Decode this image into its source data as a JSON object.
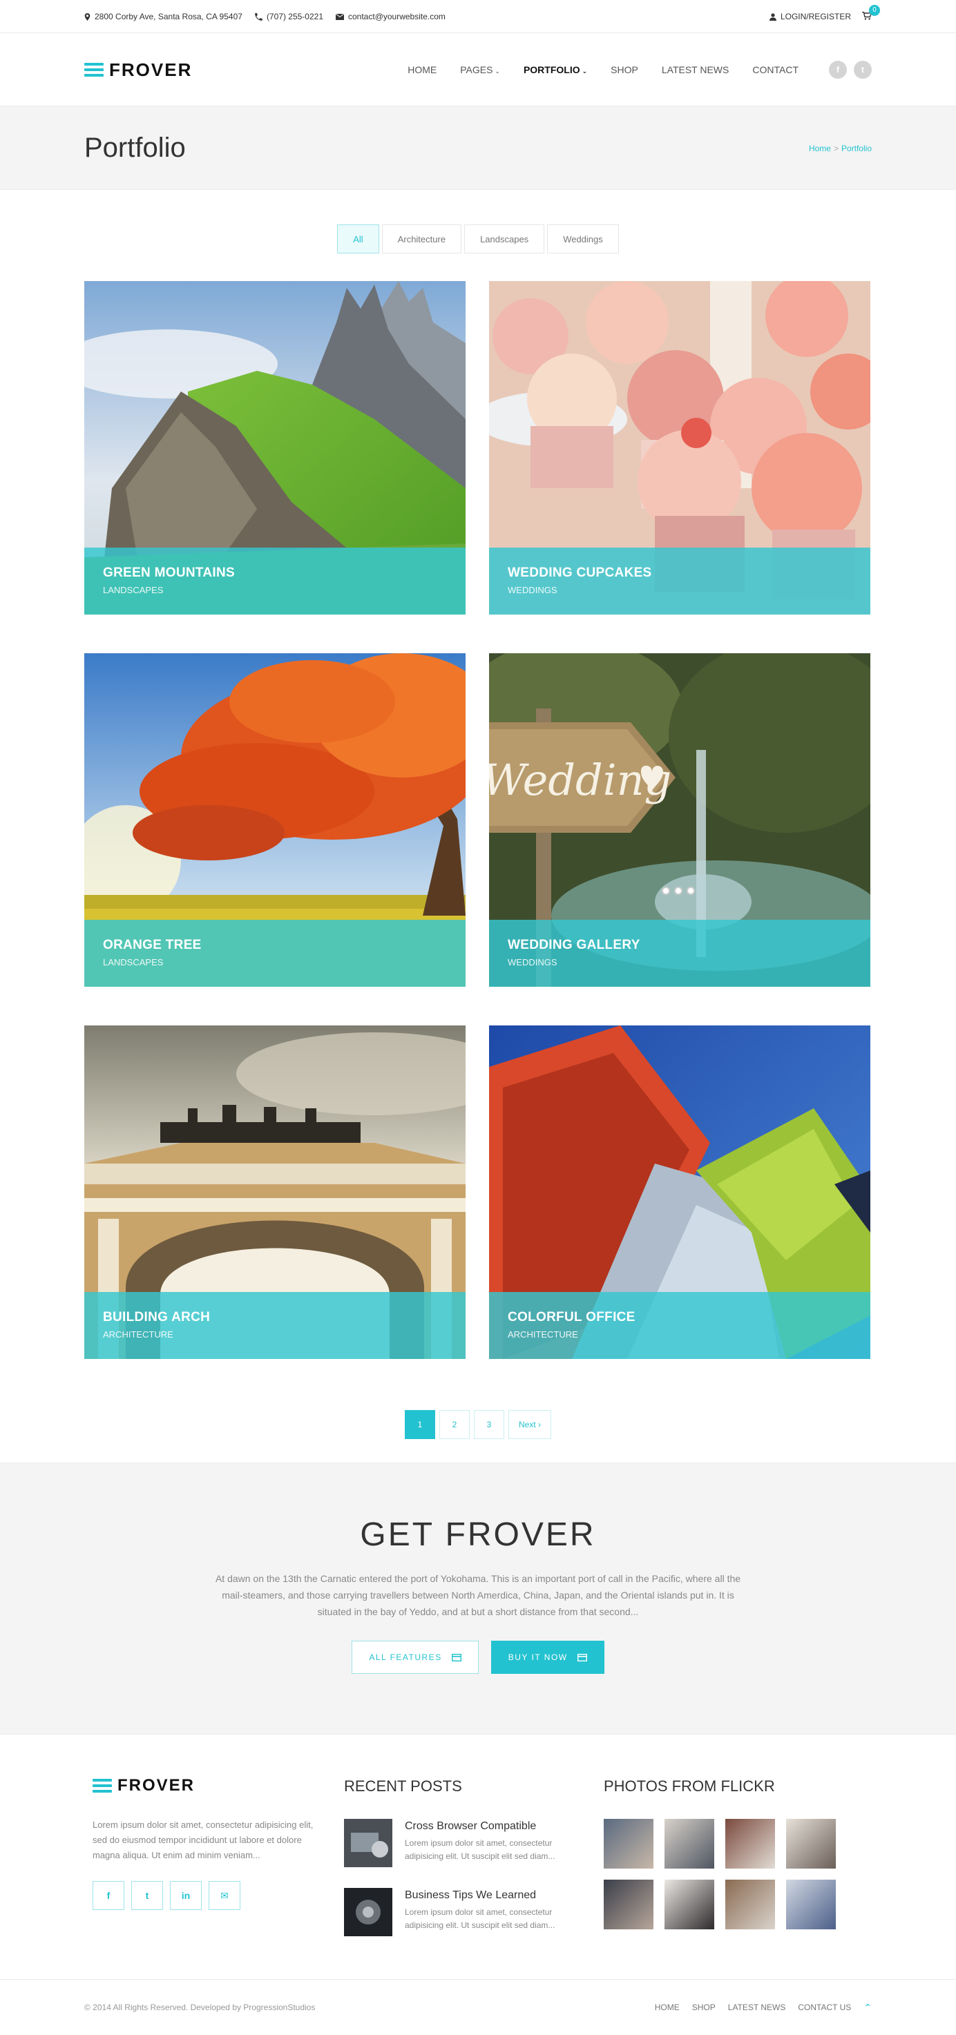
{
  "topbar": {
    "address": "2800 Corby Ave, Santa Rosa, CA 95407",
    "phone": "(707) 255-0221",
    "email": "contact@yourwebsite.com",
    "login": "LOGIN/REGISTER",
    "cart_count": "0"
  },
  "header": {
    "logo": "FROVER",
    "nav": [
      "HOME",
      "PAGES",
      "PORTFOLIO",
      "SHOP",
      "LATEST NEWS",
      "CONTACT"
    ],
    "social": [
      "f",
      "t"
    ]
  },
  "titlebar": {
    "title": "Portfolio",
    "crumb_home": "Home",
    "crumb_sep": ">",
    "crumb_current": "Portfolio"
  },
  "filters": [
    "All",
    "Architecture",
    "Landscapes",
    "Weddings"
  ],
  "portfolio": [
    {
      "title": "GREEN MOUNTAINS",
      "category": "LANDSCAPES"
    },
    {
      "title": "WEDDING CUPCAKES",
      "category": "WEDDINGS"
    },
    {
      "title": "ORANGE TREE",
      "category": "LANDSCAPES"
    },
    {
      "title": "WEDDING GALLERY",
      "category": "WEDDINGS"
    },
    {
      "title": "BUILDING ARCH",
      "category": "ARCHITECTURE"
    },
    {
      "title": "COLORFUL OFFICE",
      "category": "ARCHITECTURE"
    }
  ],
  "sign_text": "Wedding",
  "pagination": [
    "1",
    "2",
    "3",
    "Next ›"
  ],
  "promo": {
    "title": "GET FROVER",
    "text": "At dawn on the 13th the Carnatic entered the port of Yokohama. This is an important port of call in the Pacific, where all the mail-steamers, and those carrying travellers between North Amerdica, China, Japan, and the Oriental islands put in. It is situated in the bay of Yeddo, and at but a short distance from that second...",
    "btn_features": "ALL FEATURES",
    "btn_buy": "BUY IT NOW"
  },
  "footer": {
    "logo": "FROVER",
    "about": "Lorem ipsum dolor sit amet, consectetur adipisicing elit, sed do eiusmod tempor incididunt ut labore et dolore magna aliqua. Ut enim ad minim veniam...",
    "social": [
      "f",
      "t",
      "in",
      "✉"
    ],
    "recent_heading": "RECENT POSTS",
    "posts": [
      {
        "title": "Cross Browser Compatible",
        "text": "Lorem ipsum dolor sit amet, consectetur adipisicing elit. Ut suscipit elit sed diam..."
      },
      {
        "title": "Business Tips We Learned",
        "text": "Lorem ipsum dolor sit amet, consectetur adipisicing elit. Ut suscipit elit sed diam..."
      }
    ],
    "flickr_heading": "PHOTOS FROM FLICKR"
  },
  "bottom": {
    "copyright": "© 2014 All Rights Reserved. Developed by ProgressionStudios",
    "links": [
      "HOME",
      "SHOP",
      "LATEST NEWS",
      "CONTACT US"
    ]
  },
  "colors": {
    "accent": "#23c2d0",
    "overlay": "#35c7d1",
    "panel": "#f4f4f4"
  }
}
